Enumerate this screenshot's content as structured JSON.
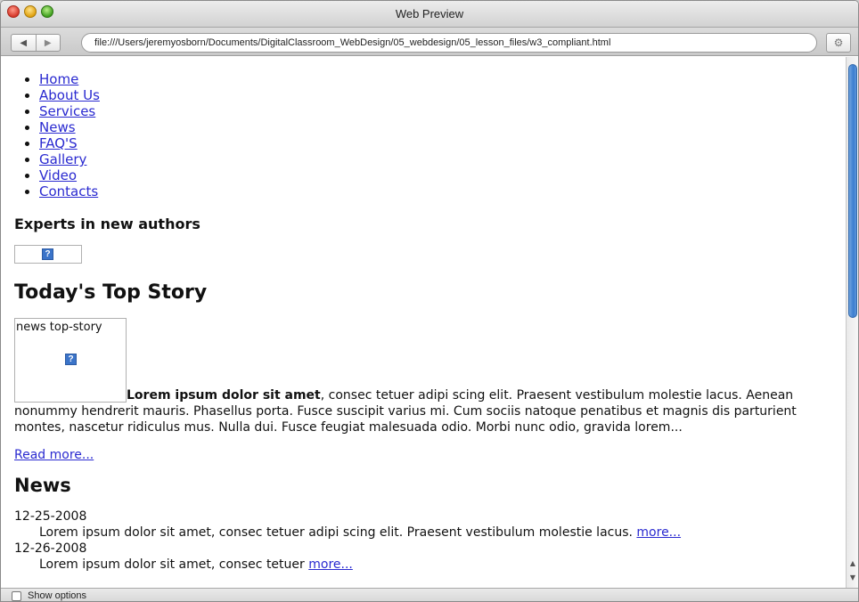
{
  "window": {
    "title": "Web Preview"
  },
  "toolbar": {
    "back_icon": "back-arrow-icon",
    "forward_icon": "forward-arrow-icon",
    "url": "file:///Users/jeremyosborn/Documents/DigitalClassroom_WebDesign/05_webdesign/05_lesson_files/w3_compliant.html",
    "gear_icon": "gear-icon"
  },
  "page": {
    "menu": [
      {
        "label": "Home"
      },
      {
        "label": "About Us"
      },
      {
        "label": "Services"
      },
      {
        "label": "News"
      },
      {
        "label": "FAQ'S"
      },
      {
        "label": "Gallery"
      },
      {
        "label": "Video"
      },
      {
        "label": "Contacts"
      }
    ],
    "experts_heading": "Experts in new authors",
    "top_story_heading": "Today's Top Story",
    "top_story_image_alt": "news top-story",
    "story_bold": "Lorem ipsum dolor sit amet",
    "story_text": ", consec tetuer adipi scing elit. Praesent vestibulum molestie lacus. Aenean nonummy hendrerit mauris. Phasellus porta. Fusce suscipit varius mi. Cum sociis natoque penatibus et magnis dis parturient montes, nascetur ridiculus mus. Nulla dui. Fusce feugiat malesuada odio. Morbi nunc odio, gravida lorem...",
    "read_more": "Read more...",
    "news_heading": "News",
    "news": [
      {
        "date": "12-25-2008",
        "text": "Lorem ipsum dolor sit amet, consec tetuer adipi scing elit. Praesent vestibulum molestie lacus. ",
        "more": "more..."
      },
      {
        "date": "12-26-2008",
        "text": "Lorem ipsum dolor sit amet, consec tetuer ",
        "more": "more..."
      }
    ]
  },
  "status": {
    "show_options": "Show options"
  }
}
